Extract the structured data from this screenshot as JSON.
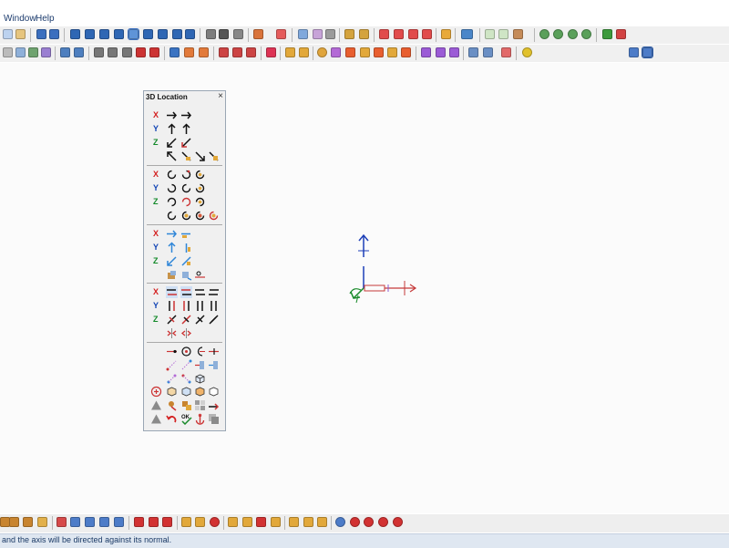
{
  "menu": {
    "window_label": "Window",
    "help_label": "Help"
  },
  "panel": {
    "title": "3D Location",
    "close_glyph": "×"
  },
  "axes": {
    "x": "X",
    "y": "Y",
    "z": "Z"
  },
  "status": {
    "message": "and the axis will be directed against its normal."
  },
  "colors": {
    "axis_x": "#d31d1d",
    "axis_y": "#1144b5",
    "axis_z": "#138a2a",
    "status_bg": "#dfe7f1",
    "toolbar_bg": "#f0f0f0"
  },
  "icons": {
    "panel": [
      "translate-arrow-icon",
      "rotate-circle-icon",
      "move-along-icon",
      "flip-icon",
      "align-icon",
      "box-icon",
      "ok-check-icon",
      "anchor-icon"
    ],
    "viewport": [
      "triad-x-arrow-icon",
      "triad-y-arrow-icon",
      "triad-z-arrow-icon"
    ]
  }
}
